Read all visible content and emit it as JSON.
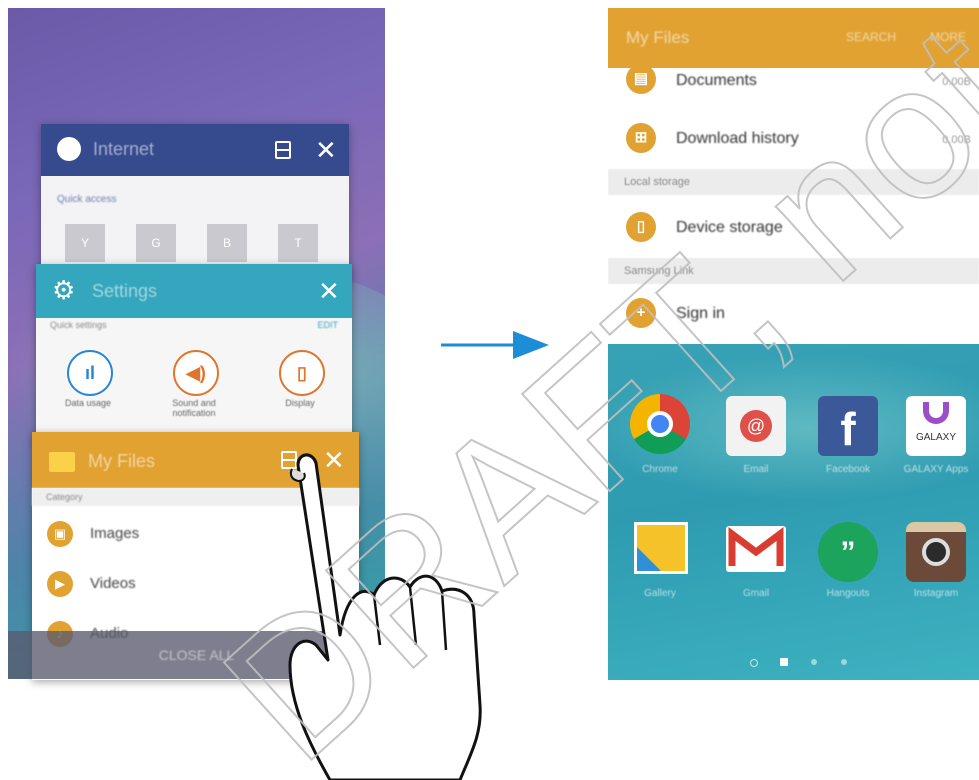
{
  "left_screen": {
    "internet_card": {
      "title": "Internet",
      "quick_access_label": "Quick access",
      "tiles": [
        "Y",
        "G",
        "B",
        "T"
      ]
    },
    "settings_card": {
      "title": "Settings",
      "quick_settings_label": "Quick settings",
      "edit_label": "EDIT",
      "items": [
        {
          "label": "Data usage",
          "icon": "bar-chart-icon",
          "color": "#2a86d6"
        },
        {
          "label": "Sound and notification",
          "icon": "speaker-icon",
          "color": "#e0762e"
        },
        {
          "label": "Display",
          "icon": "display-icon",
          "color": "#e0762e"
        }
      ]
    },
    "myfiles_card": {
      "title": "My Files",
      "category_label": "Category",
      "rows": [
        {
          "label": "Images",
          "icon": "image-icon"
        },
        {
          "label": "Videos",
          "icon": "video-icon"
        },
        {
          "label": "Audio",
          "icon": "music-icon"
        }
      ]
    },
    "close_all_label": "CLOSE ALL"
  },
  "right_screen": {
    "myfiles": {
      "title": "My Files",
      "search_label": "SEARCH",
      "more_label": "MORE",
      "rows": [
        {
          "label": "Documents",
          "size": "0.00B",
          "icon": "document-icon"
        },
        {
          "label": "Download history",
          "size": "0.00B",
          "icon": "download-icon"
        }
      ],
      "local_storage_label": "Local storage",
      "device_storage_label": "Device storage",
      "samsung_link_label": "Samsung Link",
      "sign_in_label": "Sign in"
    },
    "apps_row1": [
      {
        "label": "Chrome",
        "icon": "chrome-icon"
      },
      {
        "label": "Email",
        "icon": "email-icon"
      },
      {
        "label": "Facebook",
        "icon": "facebook-icon"
      },
      {
        "label": "GALAXY Apps",
        "icon": "galaxy-apps-icon"
      }
    ],
    "apps_row2": [
      {
        "label": "Gallery",
        "icon": "gallery-icon"
      },
      {
        "label": "Gmail",
        "icon": "gmail-icon"
      },
      {
        "label": "Hangouts",
        "icon": "hangouts-icon"
      },
      {
        "label": "Instagram",
        "icon": "instagram-icon"
      }
    ],
    "galaxy_badge": "GALAXY",
    "page_count": 4,
    "current_page": 2
  },
  "watermark": "DRAFT, not FINAL",
  "colors": {
    "myfiles": "#e1a232",
    "internet": "#364a8e",
    "settings": "#34a6bd",
    "arrow": "#1d8ed6"
  }
}
